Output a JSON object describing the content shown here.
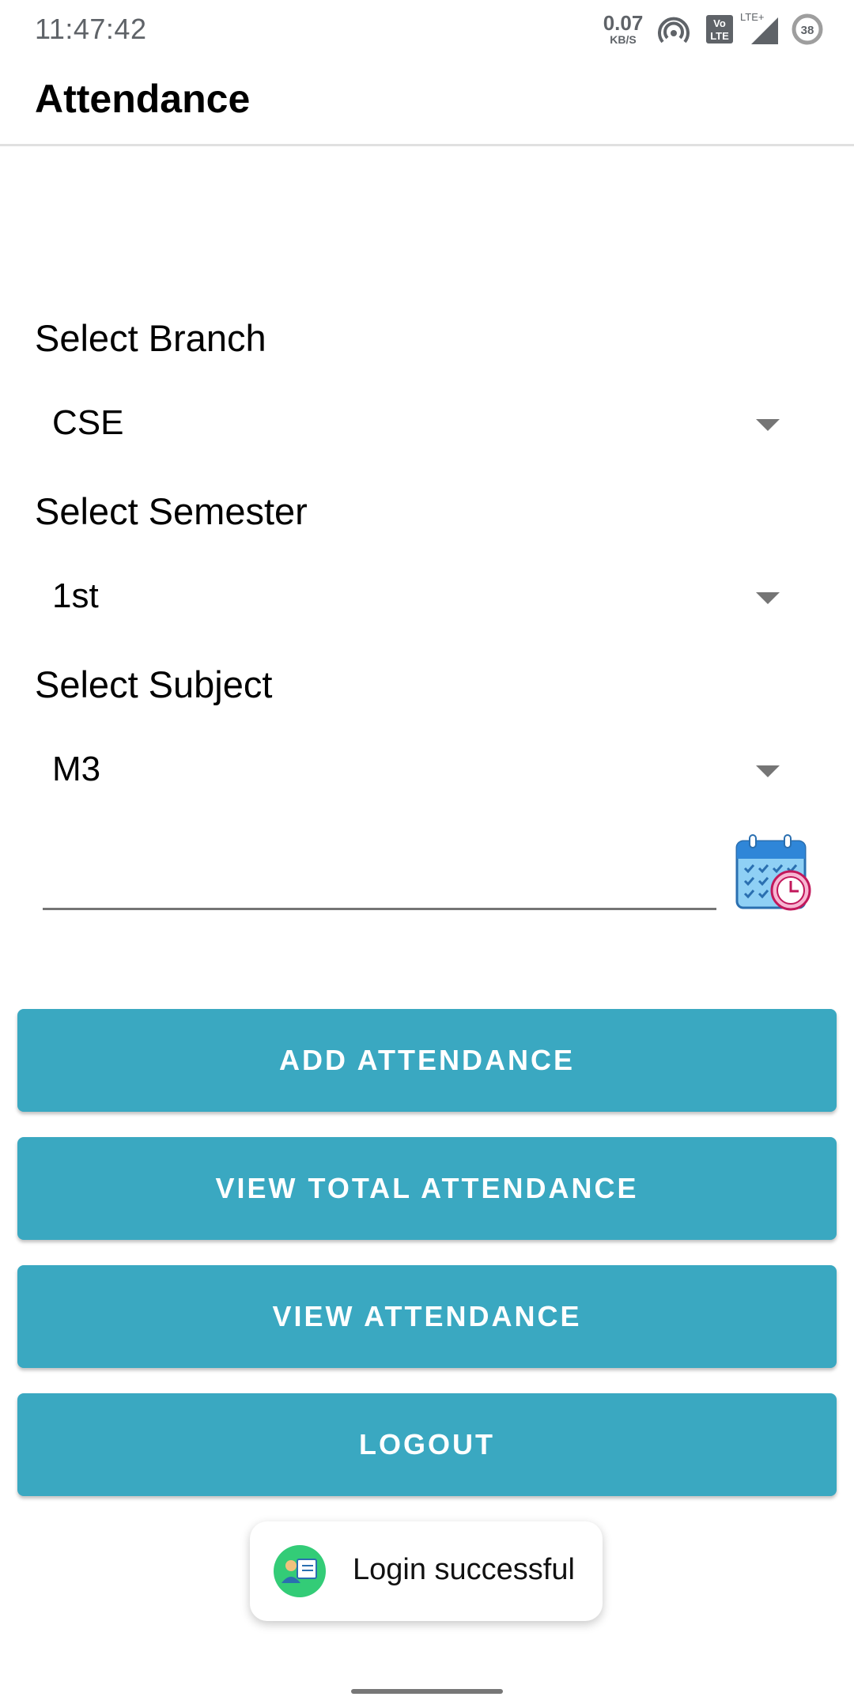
{
  "status_bar": {
    "time": "11:47:42",
    "net_speed_value": "0.07",
    "net_speed_unit": "KB/S",
    "network_label": "LTE+",
    "volte_label_top": "Vo",
    "volte_label_bottom": "LTE",
    "battery_level": "38",
    "icons": [
      "hotspot-icon",
      "volte-icon",
      "signal-icon",
      "battery-icon"
    ]
  },
  "app_bar": {
    "title": "Attendance"
  },
  "form": {
    "branch": {
      "label": "Select Branch",
      "value": "CSE"
    },
    "semester": {
      "label": "Select Semester",
      "value": "1st"
    },
    "subject": {
      "label": "Select Subject",
      "value": "M3"
    },
    "date": {
      "value": "",
      "icon": "calendar-clock-icon"
    }
  },
  "buttons": {
    "add": "ADD ATTENDANCE",
    "view_total": "VIEW TOTAL ATTENDANCE",
    "view": "VIEW ATTENDANCE",
    "logout": "LOGOUT"
  },
  "toast": {
    "message": "Login successful",
    "icon": "app-icon"
  },
  "colors": {
    "button": "#3aa8c1",
    "text": "#000000",
    "status_text": "#5f6368",
    "toast_icon": "#33cc77"
  }
}
